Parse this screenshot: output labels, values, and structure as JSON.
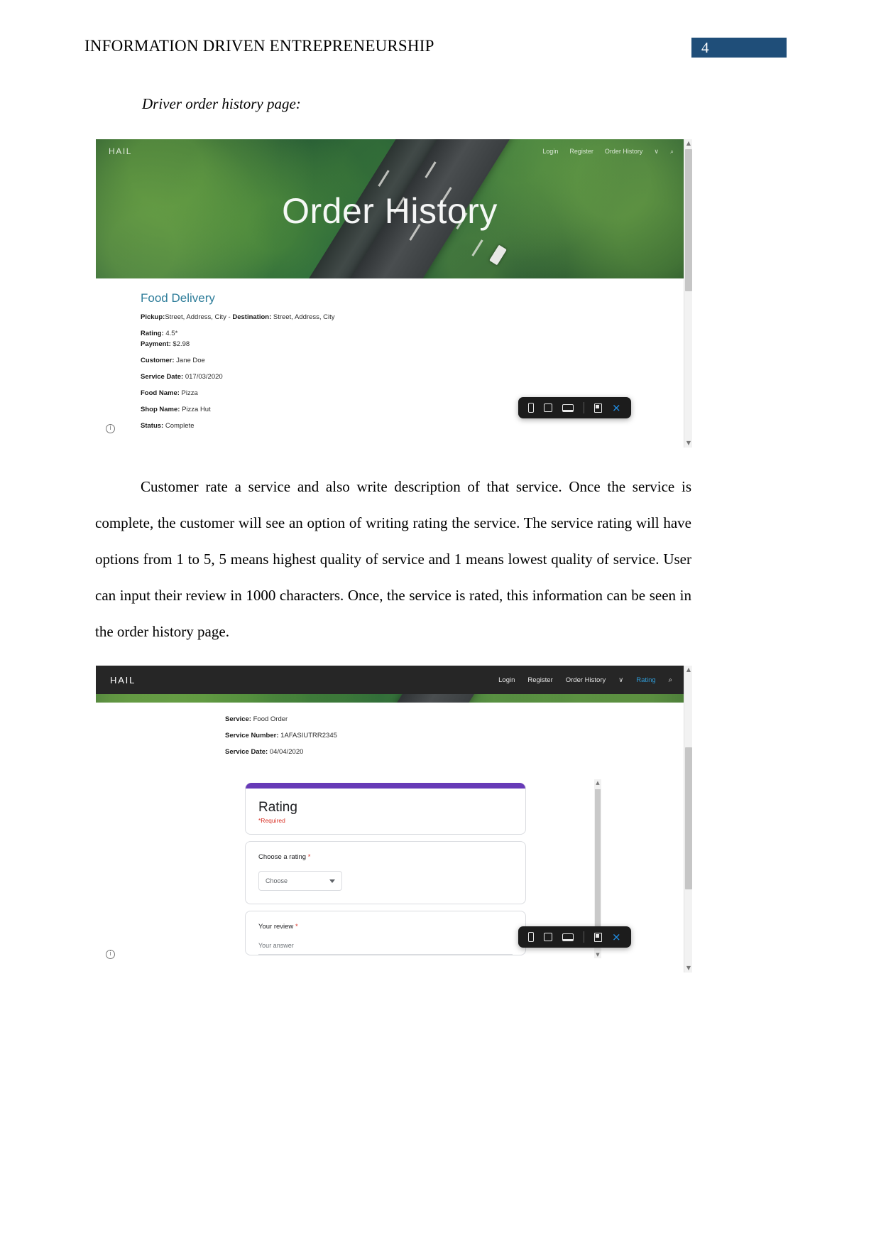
{
  "header": {
    "document_title": "INFORMATION DRIVEN ENTREPRENEURSHIP",
    "page_number": "4"
  },
  "caption": "Driver order history page:",
  "screenshot1": {
    "nav": {
      "logo": "HAIL",
      "links": [
        "Login",
        "Register",
        "Order History"
      ],
      "dropdown_caret": "∨",
      "search_icon": "⌕"
    },
    "hero_title": "Order History",
    "order": {
      "title": "Food Delivery",
      "rows": [
        {
          "label": "Pickup:",
          "value": "Street, Address, City - ",
          "label2": "Destination:",
          "value2": " Street, Address, City"
        },
        {
          "label": "Rating:",
          "value": " 4.5*"
        },
        {
          "label": "Payment:",
          "value": " $2.98"
        },
        {
          "label": "Customer:",
          "value": " Jane Doe"
        },
        {
          "label": "Service Date:",
          "value": " 017/03/2020"
        },
        {
          "label": "Food Name:",
          "value": " Pizza"
        },
        {
          "label": "Shop Name:",
          "value": " Pizza Hut"
        },
        {
          "label": "Status:",
          "value": " Complete"
        }
      ]
    },
    "device_toolbar": {
      "icons": [
        "phone-icon",
        "tablet-icon",
        "laptop-icon",
        "flag-icon"
      ],
      "close_label": "×"
    },
    "info_icon": "i",
    "scrollbar": {
      "up": "▲",
      "down": "▼"
    }
  },
  "paragraph": "Customer rate a service and also write description of that service. Once the service is complete, the customer will see an option of writing rating the service. The service rating will have options from 1 to 5, 5 means highest quality of service and 1 means lowest quality of service. User can input their review in 1000 characters. Once, the service is rated, this information can be seen in the order history page.",
  "screenshot2": {
    "nav": {
      "logo": "HAIL",
      "links": [
        "Login",
        "Register",
        "Order History",
        "Rating"
      ],
      "active_link": "Rating",
      "dropdown_caret": "∨",
      "search_icon": "⌕"
    },
    "service": {
      "rows": [
        {
          "label": "Service:",
          "value": " Food Order"
        },
        {
          "label": "Service Number:",
          "value": " 1AFASIUTRR2345"
        },
        {
          "label": "Service Date:",
          "value": " 04/04/2020"
        }
      ]
    },
    "form": {
      "accent_color": "#673ab7",
      "title": "Rating",
      "required_note": "*Required",
      "question1_label": "Choose a rating ",
      "question1_required": "*",
      "select_value": "Choose",
      "question2_label": "Your review ",
      "question2_required": "*",
      "answer_placeholder": "Your answer"
    },
    "device_toolbar": {
      "icons": [
        "phone-icon",
        "tablet-icon",
        "laptop-icon",
        "flag-icon"
      ],
      "close_label": "×"
    },
    "info_icon": "i",
    "scrollbar": {
      "up": "▲",
      "down": "▼"
    }
  }
}
